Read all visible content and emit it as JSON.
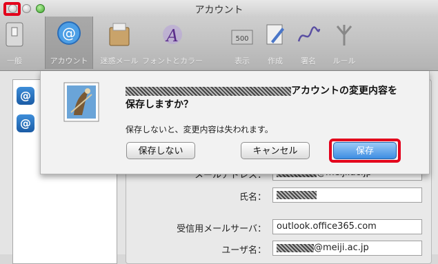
{
  "window": {
    "title": "アカウント"
  },
  "toolbar": {
    "items": [
      {
        "label": "一般",
        "icon": "switch-icon"
      },
      {
        "label": "アカウント",
        "icon": "at-icon"
      },
      {
        "label": "迷惑メール",
        "icon": "junk-mail-icon"
      },
      {
        "label": "フォントとカラー",
        "icon": "font-color-icon"
      },
      {
        "label": "表示",
        "icon": "view-icon"
      },
      {
        "label": "作成",
        "icon": "compose-icon"
      },
      {
        "label": "署名",
        "icon": "signature-icon"
      },
      {
        "label": "ルール",
        "icon": "rules-icon"
      }
    ]
  },
  "dialog": {
    "title_line1_suffix": "アカウントの変更内容を",
    "title_line2": "保存しますか？",
    "message": "保存しないと、変更内容は失われます。",
    "buttons": {
      "dont_save": "保存しない",
      "cancel": "キャンセル",
      "save": "保存"
    }
  },
  "form": {
    "email_label": "メールアドレス：",
    "email_value": "@meiji.ac.jp",
    "fullname_label": "氏名：",
    "incoming_server_label": "受信用メールサーバ：",
    "incoming_server_value": "outlook.office365.com",
    "username_label": "ユーザ名：",
    "username_value": "@meiji.ac.jp"
  },
  "colors": {
    "highlight": "#e3001b",
    "primary_button": "#3d8de2",
    "accent_blue": "#1a5ba5"
  }
}
